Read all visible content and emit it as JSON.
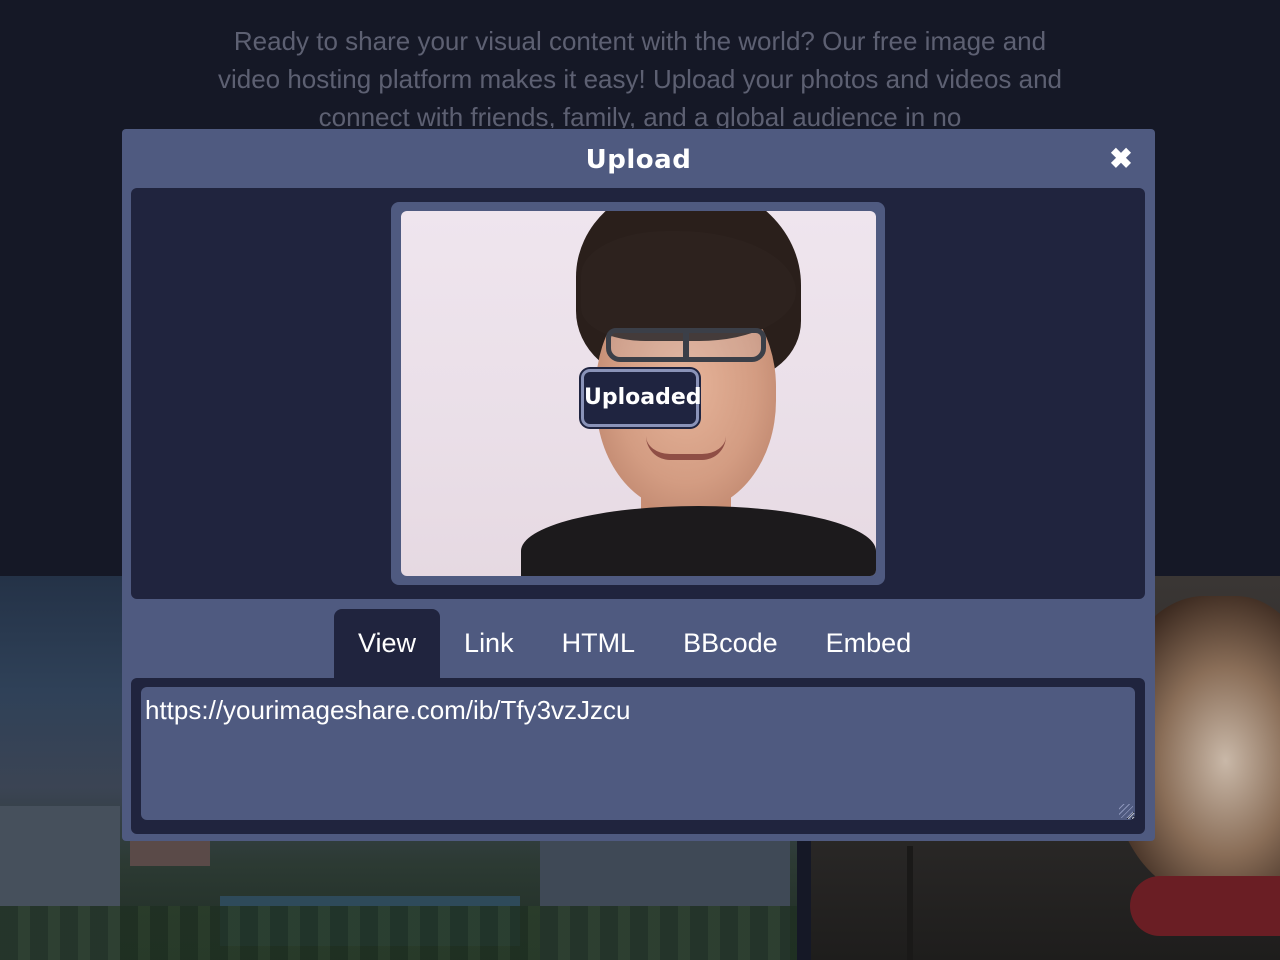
{
  "background": {
    "intro_text": "Ready to share your visual content with the world? Our free image and video hosting platform makes it easy! Upload your photos and videos and connect with friends, family, and a global audience in no"
  },
  "modal": {
    "title": "Upload",
    "close_icon": "close-icon",
    "badge": "Uploaded",
    "tabs": [
      {
        "label": "View",
        "active": true
      },
      {
        "label": "Link",
        "active": false
      },
      {
        "label": "HTML",
        "active": false
      },
      {
        "label": "BBcode",
        "active": false
      },
      {
        "label": "Embed",
        "active": false
      }
    ],
    "link_value": "https://yourimageshare.com/ib/Tfy3vzJzcu"
  },
  "colors": {
    "page_bg": "#151826",
    "modal_bg": "#4f5a80",
    "panel_bg": "#20243e",
    "text": "#ffffff"
  }
}
